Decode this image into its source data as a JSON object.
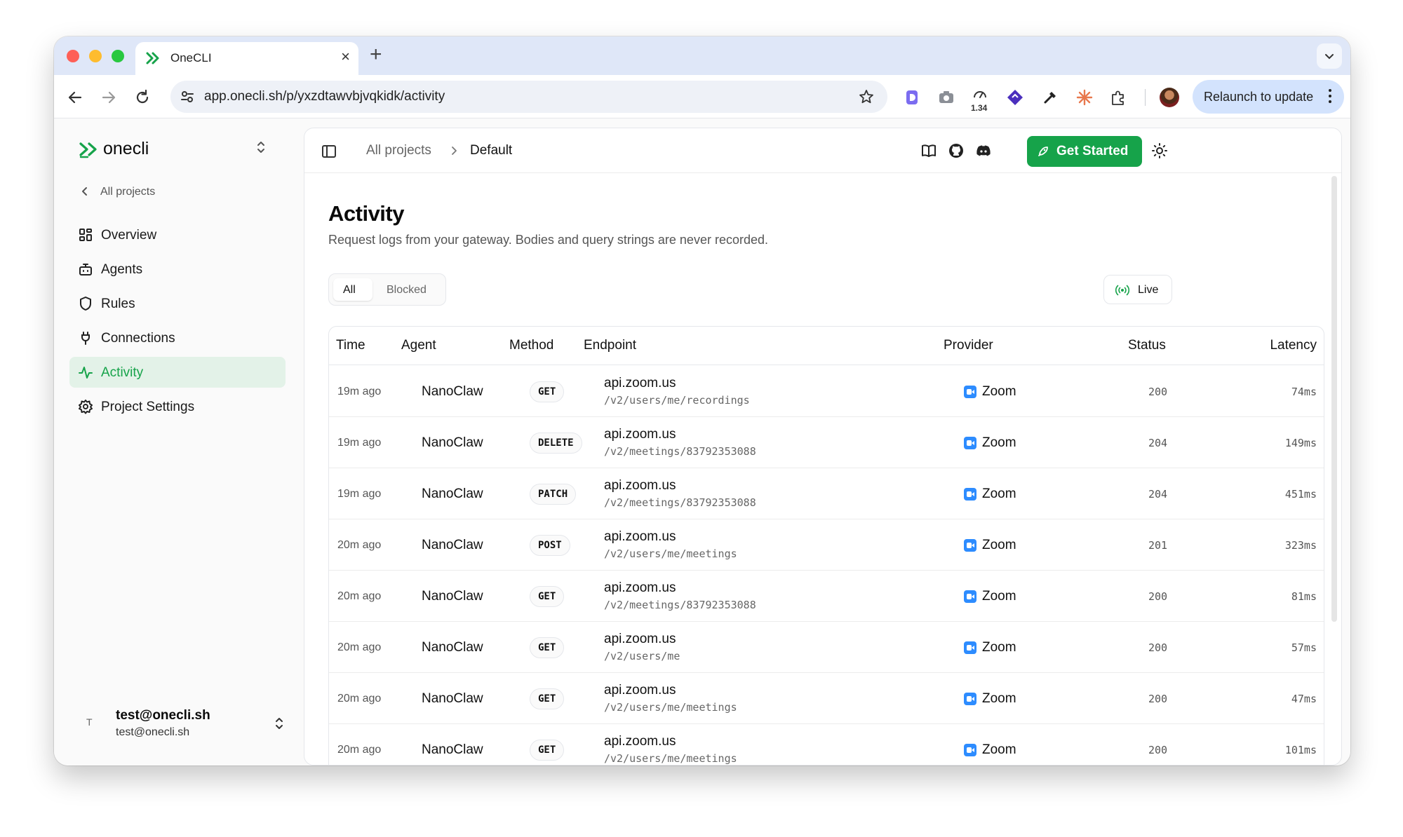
{
  "browser": {
    "tab_title": "OneCLI",
    "url": "app.onecli.sh/p/yxzdtawvbjvqkidk/activity",
    "extension_badge": "1.34",
    "relaunch_label": "Relaunch to update"
  },
  "sidebar": {
    "brand": "onecli",
    "back_label": "All projects",
    "items": [
      {
        "label": "Overview",
        "icon": "grid-icon"
      },
      {
        "label": "Agents",
        "icon": "bot-icon"
      },
      {
        "label": "Rules",
        "icon": "shield-icon"
      },
      {
        "label": "Connections",
        "icon": "plug-icon"
      },
      {
        "label": "Activity",
        "icon": "activity-icon",
        "active": true
      },
      {
        "label": "Project Settings",
        "icon": "gear-icon"
      }
    ],
    "user": {
      "initial": "T",
      "name": "test@onecli.sh",
      "email": "test@onecli.sh"
    }
  },
  "header": {
    "breadcrumb_root": "All projects",
    "breadcrumb_current": "Default",
    "get_started_label": "Get Started"
  },
  "page": {
    "title": "Activity",
    "subtitle": "Request logs from your gateway. Bodies and query strings are never recorded.",
    "filters": {
      "all": "All",
      "blocked": "Blocked",
      "selected": "All"
    },
    "live_label": "Live"
  },
  "table": {
    "columns": [
      "Time",
      "Agent",
      "Method",
      "Endpoint",
      "Provider",
      "Status",
      "Latency"
    ],
    "rows": [
      {
        "time": "19m ago",
        "agent": "NanoClaw",
        "method": "GET",
        "host": "api.zoom.us",
        "path": "/v2/users/me/recordings",
        "provider": "Zoom",
        "status": "200",
        "latency": "74ms"
      },
      {
        "time": "19m ago",
        "agent": "NanoClaw",
        "method": "DELETE",
        "host": "api.zoom.us",
        "path": "/v2/meetings/83792353088",
        "provider": "Zoom",
        "status": "204",
        "latency": "149ms"
      },
      {
        "time": "19m ago",
        "agent": "NanoClaw",
        "method": "PATCH",
        "host": "api.zoom.us",
        "path": "/v2/meetings/83792353088",
        "provider": "Zoom",
        "status": "204",
        "latency": "451ms"
      },
      {
        "time": "20m ago",
        "agent": "NanoClaw",
        "method": "POST",
        "host": "api.zoom.us",
        "path": "/v2/users/me/meetings",
        "provider": "Zoom",
        "status": "201",
        "latency": "323ms"
      },
      {
        "time": "20m ago",
        "agent": "NanoClaw",
        "method": "GET",
        "host": "api.zoom.us",
        "path": "/v2/meetings/83792353088",
        "provider": "Zoom",
        "status": "200",
        "latency": "81ms"
      },
      {
        "time": "20m ago",
        "agent": "NanoClaw",
        "method": "GET",
        "host": "api.zoom.us",
        "path": "/v2/users/me",
        "provider": "Zoom",
        "status": "200",
        "latency": "57ms"
      },
      {
        "time": "20m ago",
        "agent": "NanoClaw",
        "method": "GET",
        "host": "api.zoom.us",
        "path": "/v2/users/me/meetings",
        "provider": "Zoom",
        "status": "200",
        "latency": "47ms"
      },
      {
        "time": "20m ago",
        "agent": "NanoClaw",
        "method": "GET",
        "host": "api.zoom.us",
        "path": "/v2/users/me/meetings",
        "provider": "Zoom",
        "status": "200",
        "latency": "101ms"
      }
    ]
  },
  "colors": {
    "accent": "#16a34a",
    "active_bg": "#e3f2e8",
    "zoom": "#2d8cff"
  }
}
